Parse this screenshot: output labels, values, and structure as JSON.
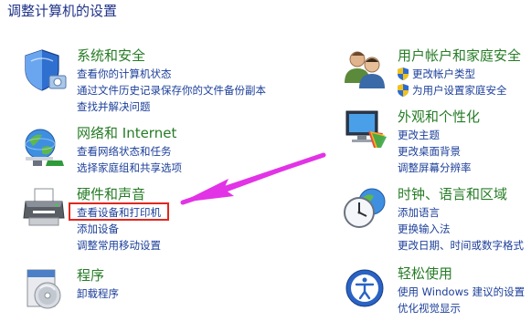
{
  "page": {
    "title": "调整计算机的设置"
  },
  "left": [
    {
      "id": "system",
      "title": "系统和安全",
      "icon": "shield-security-icon",
      "links": [
        "查看你的计算机状态",
        "通过文件历史记录保存你的文件备份副本",
        "查找并解决问题"
      ]
    },
    {
      "id": "network",
      "title": "网络和 Internet",
      "icon": "network-globe-icon",
      "links": [
        "查看网络状态和任务",
        "选择家庭组和共享选项"
      ]
    },
    {
      "id": "hardware",
      "title": "硬件和声音",
      "icon": "printer-icon",
      "links": [
        "查看设备和打印机",
        "添加设备",
        "调整常用移动设置"
      ]
    },
    {
      "id": "programs",
      "title": "程序",
      "icon": "programs-disc-icon",
      "links": [
        "卸载程序"
      ]
    }
  ],
  "right": [
    {
      "id": "users",
      "title": "用户帐户和家庭安全",
      "icon": "users-icon",
      "links": [
        "更改帐户类型",
        "为用户设置家庭安全"
      ]
    },
    {
      "id": "appearance",
      "title": "外观和个性化",
      "icon": "monitor-palette-icon",
      "links": [
        "更改主题",
        "更改桌面背景",
        "调整屏幕分辨率"
      ]
    },
    {
      "id": "clock",
      "title": "时钟、语言和区域",
      "icon": "clock-globe-icon",
      "links": [
        "添加语言",
        "更换输入法",
        "更改日期、时间或数字格式"
      ]
    },
    {
      "id": "ease",
      "title": "轻松使用",
      "icon": "ease-of-access-icon",
      "links": [
        "使用 Windows 建议的设置",
        "优化视觉显示"
      ]
    }
  ],
  "colors": {
    "title": "#1e3287",
    "category": "#267c26",
    "link": "#1c3f9a",
    "highlight": "#e0271f",
    "arrow": "#e233e6"
  }
}
